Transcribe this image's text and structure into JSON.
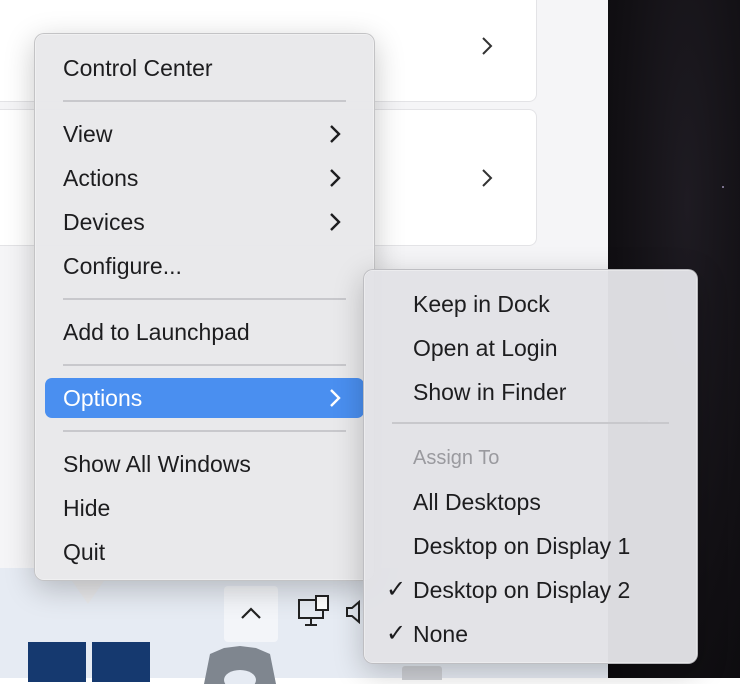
{
  "main_menu": {
    "items": [
      {
        "label": "Control Center"
      },
      {
        "label": "View"
      },
      {
        "label": "Actions"
      },
      {
        "label": "Devices"
      },
      {
        "label": "Configure..."
      },
      {
        "label": "Add to Launchpad"
      },
      {
        "label": "Options"
      },
      {
        "label": "Show All Windows"
      },
      {
        "label": "Hide"
      },
      {
        "label": "Quit"
      }
    ]
  },
  "options_submenu": {
    "items": [
      {
        "label": "Keep in Dock"
      },
      {
        "label": "Open at Login"
      },
      {
        "label": "Show in Finder"
      }
    ],
    "assign_header": "Assign To",
    "assign_items": [
      {
        "label": "All Desktops",
        "checked": false
      },
      {
        "label": "Desktop on Display 1",
        "checked": false
      },
      {
        "label": "Desktop on Display 2",
        "checked": true,
        "check_mark": "✓"
      },
      {
        "label": "None",
        "checked": true,
        "check_mark": "✓"
      }
    ]
  },
  "icons": {
    "submenu_arrow": "chevron-right-icon",
    "check": "checkmark-icon",
    "taskbar": [
      "chevron-up-icon",
      "monitor-icon",
      "speaker-icon",
      "gear-icon"
    ]
  },
  "colors": {
    "highlight": "#4a8ff0",
    "menu_bg": "#e8e8ea",
    "taskbar_tile": "#15396f"
  }
}
